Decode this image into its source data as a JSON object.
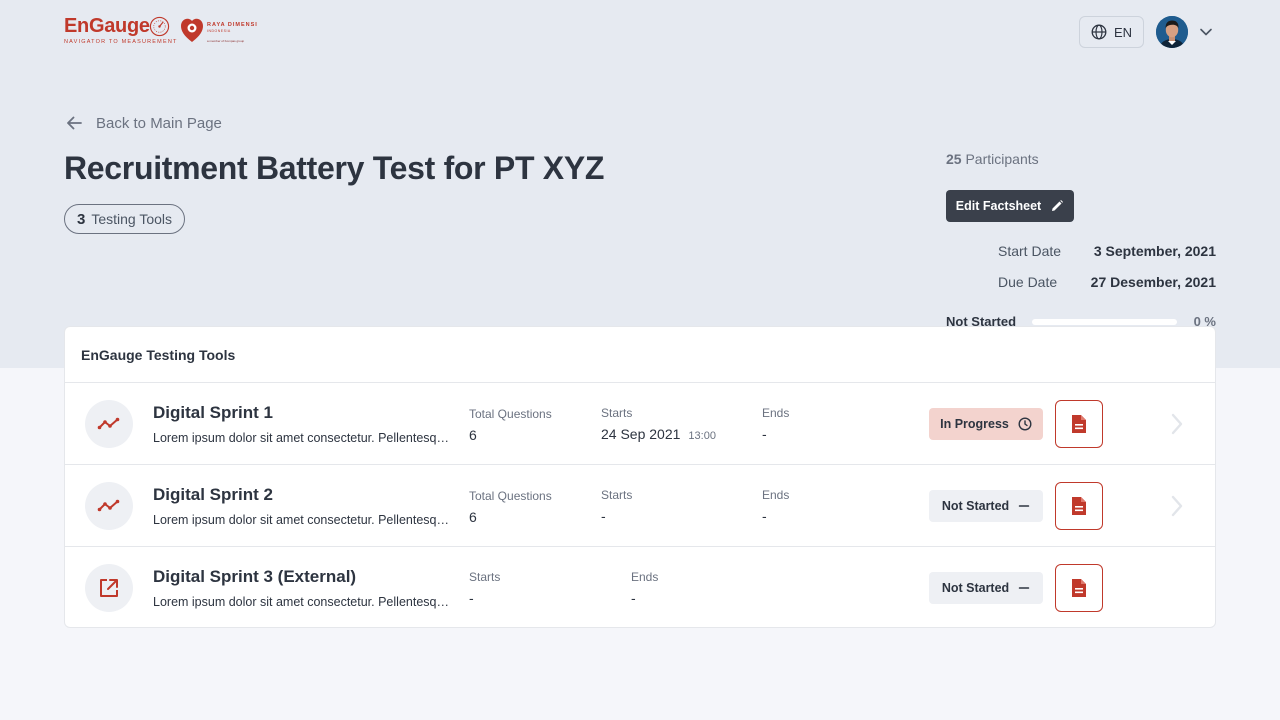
{
  "header": {
    "brand_word": "EnGauge",
    "brand_tagline": "NAVIGATOR TO MEASUREMENT",
    "partner_name": "RAYA DIMENSI",
    "partner_sub": "INDONESIA",
    "partner_member": "a member of Kompas group",
    "language": "EN"
  },
  "nav": {
    "back_label": "Back to Main Page"
  },
  "page": {
    "title": "Recruitment Battery Test for PT XYZ",
    "tools_count": "3",
    "tools_label": "Testing Tools"
  },
  "summary": {
    "participants_count": "25",
    "participants_label": "Participants",
    "edit_label": "Edit Factsheet",
    "start_label": "Start Date",
    "start_value": "3 September, 2021",
    "due_label": "Due Date",
    "due_value": "27 Desember, 2021",
    "progress_status": "Not Started",
    "progress_percent": "0 %",
    "progress_fraction": 0
  },
  "card": {
    "title": "EnGauge Testing Tools",
    "rows": [
      {
        "name": "Digital Sprint 1",
        "desc": "Lorem ipsum dolor sit amet consectetur. Pellentesque....",
        "questions_label": "Total Questions",
        "questions_value": "6",
        "starts_label": "Starts",
        "starts_value": "24 Sep 2021",
        "starts_time": "13:00",
        "ends_label": "Ends",
        "ends_value": "-",
        "status": "In Progress",
        "status_icon": "clock-icon",
        "row_icon": "trend-line-icon"
      },
      {
        "name": "Digital Sprint 2",
        "desc": "Lorem ipsum dolor sit amet consectetur. Pellentesque....",
        "questions_label": "Total Questions",
        "questions_value": "6",
        "starts_label": "Starts",
        "starts_value": "-",
        "ends_label": "Ends",
        "ends_value": "-",
        "status": "Not Started",
        "status_icon": "minus-icon",
        "row_icon": "trend-line-icon"
      },
      {
        "name": "Digital Sprint 3 (External)",
        "desc": "Lorem ipsum dolor sit amet consectetur. Pellentesque....",
        "starts_label": "Starts",
        "starts_value": "-",
        "ends_label": "Ends",
        "ends_value": "-",
        "status": "Not Started",
        "status_icon": "minus-icon",
        "row_icon": "external-link-icon"
      }
    ]
  },
  "colors": {
    "brand_red": "#c0392b",
    "header_band": "#e6eaf1",
    "page_bg": "#f5f6fa",
    "dark_button": "#3a404b",
    "in_progress_bg": "#f3d3ce",
    "not_started_bg": "#eef0f4"
  }
}
